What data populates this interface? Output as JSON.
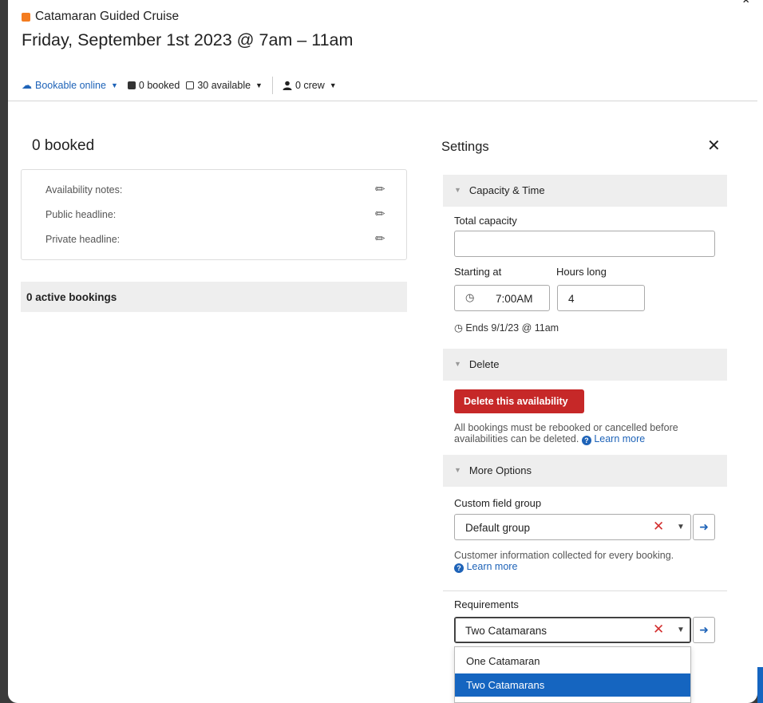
{
  "header": {
    "product_name": "Catamaran Guided Cruise",
    "product_color": "#f47c20",
    "title": "Friday, September 1st 2023 @ 7am – 11am"
  },
  "toolbar": {
    "bookable_label": "Bookable online",
    "booked_label": "0 booked",
    "available_label": "30 available",
    "crew_label": "0 crew"
  },
  "left": {
    "booked_title": "0 booked",
    "notes": [
      {
        "label": "Availability notes:"
      },
      {
        "label": "Public headline:"
      },
      {
        "label": "Private headline:"
      }
    ],
    "active_bookings": "0 active bookings"
  },
  "settings": {
    "title": "Settings",
    "capacity_section": "Capacity & Time",
    "total_capacity_label": "Total capacity",
    "total_capacity_value": "",
    "starting_at_label": "Starting at",
    "starting_at_value": "7:00AM",
    "hours_long_label": "Hours long",
    "hours_long_value": "4",
    "ends_text": "Ends 9/1/23 @ 11am",
    "delete_section": "Delete",
    "delete_button": "Delete this availability",
    "delete_help": "All bookings must be rebooked or cancelled before availabilities can be deleted.",
    "learn_more": "Learn more",
    "more_options_section": "More Options",
    "custom_field_label": "Custom field group",
    "custom_field_value": "Default group",
    "custom_field_help": "Customer information collected for every booking.",
    "custom_field_learn_more": "Learn more",
    "requirements_label": "Requirements",
    "requirements_value": "Two Catamarans",
    "requirement_options": [
      "One Catamaran",
      "Two Catamarans"
    ],
    "requirement_selected_index": 1
  },
  "colors": {
    "accent": "#1e63b8",
    "danger": "#c62828",
    "selection": "#1565c0"
  }
}
